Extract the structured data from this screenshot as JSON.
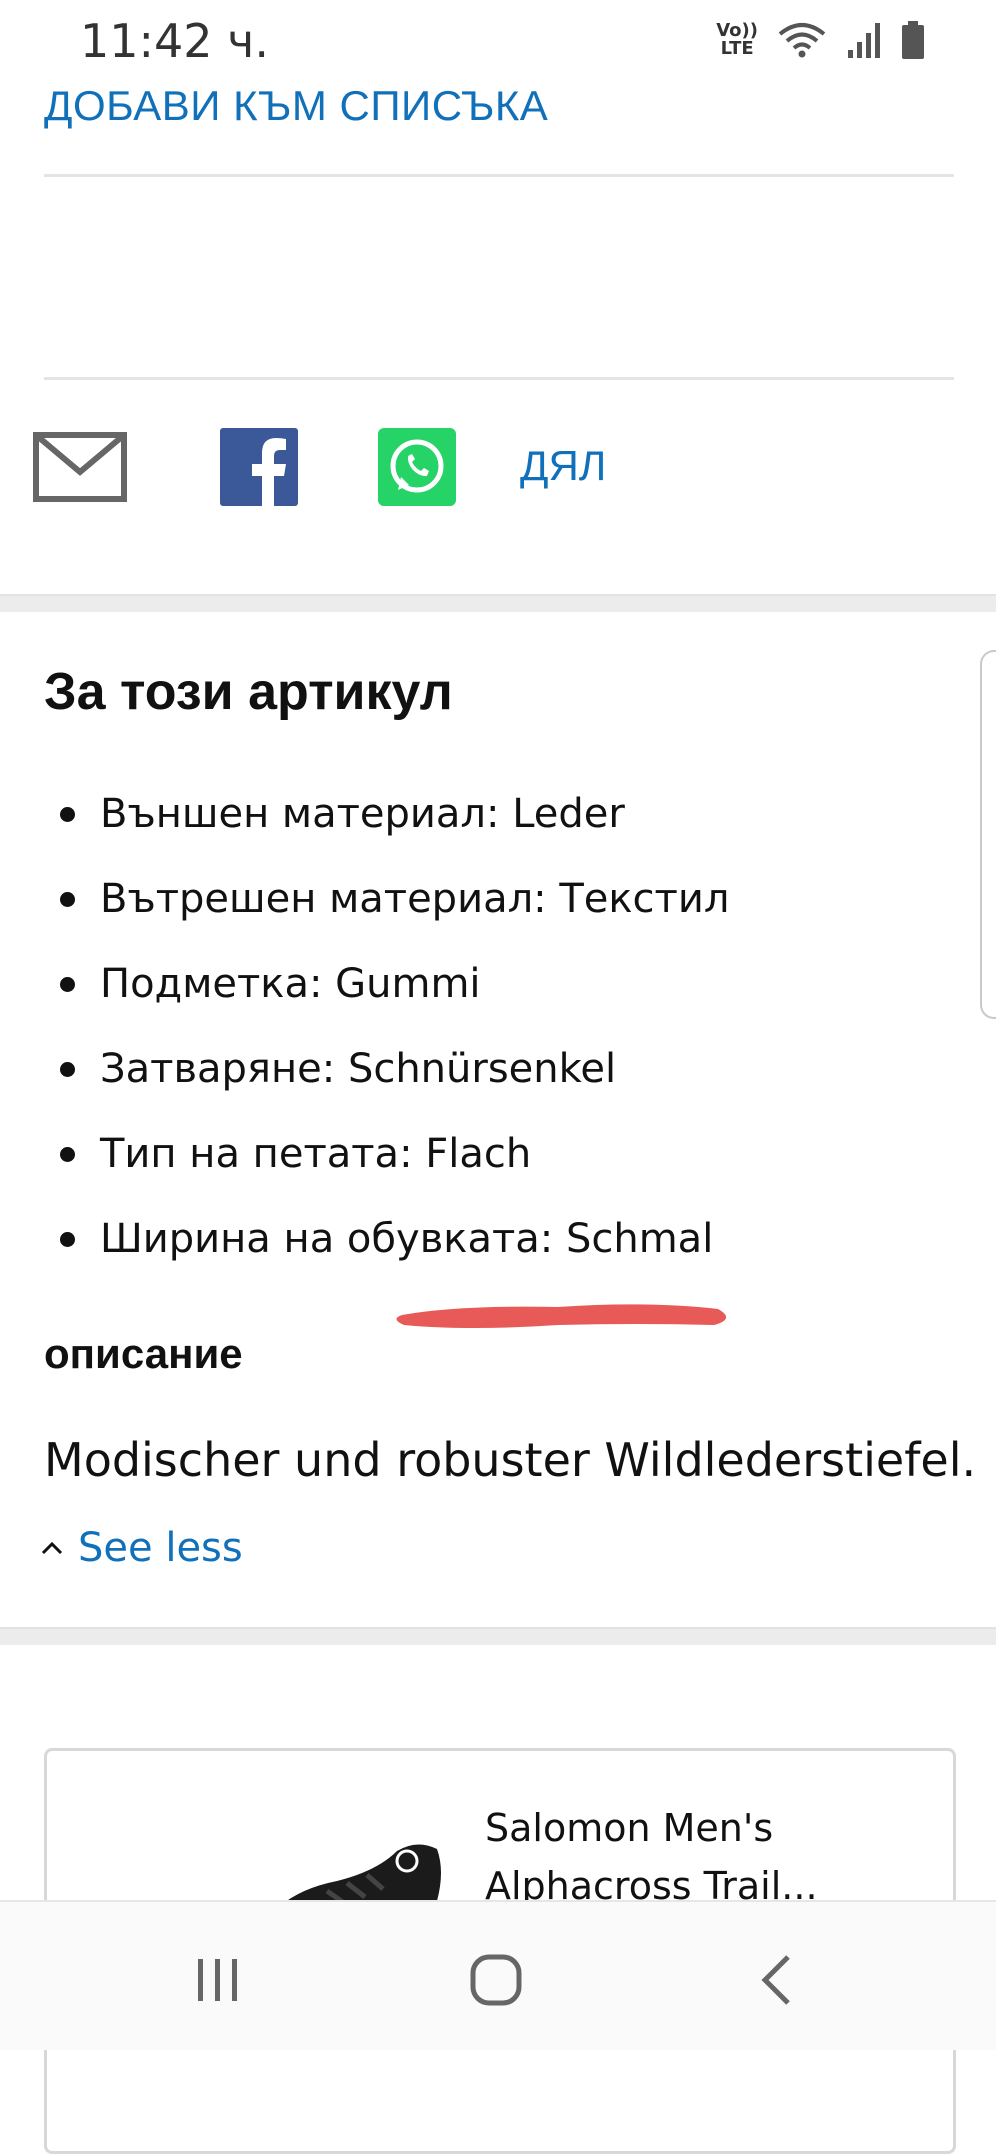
{
  "status_bar": {
    "time": "11:42 ч.",
    "volte_top": "Vo))",
    "volte_bottom": "LTE",
    "icons": [
      "volte-lte-icon",
      "wifi-icon",
      "signal-icon",
      "battery-icon"
    ]
  },
  "add_to_list": "ДОБАВИ КЪМ СПИСЪКА",
  "share": {
    "icons": [
      "email-icon",
      "facebook-icon",
      "whatsapp-icon"
    ],
    "label": "ДЯЛ"
  },
  "about": {
    "title": "За този артикул",
    "features": [
      "Външен материал: Leder",
      "Вътрешен материал: Текстил",
      "Подметка: Gummi",
      "Затваряне: Schnürsenkel",
      "Тип на петата: Flach",
      "Ширина на обувката: Schmal"
    ]
  },
  "description": {
    "title": "описание",
    "text": "Modischer und robuster Wildlederstiefel.",
    "toggle_label": "See less"
  },
  "product_card": {
    "title_line1": "Salomon Men's",
    "title_line2": "Alphacross Trail..."
  },
  "nav_bar": {
    "icons": [
      "recent-apps-icon",
      "home-icon",
      "back-icon"
    ]
  },
  "colors": {
    "link": "#1170ba",
    "facebook": "#3b5998",
    "whatsapp": "#25d366",
    "highlight_mark": "#e85a57"
  }
}
